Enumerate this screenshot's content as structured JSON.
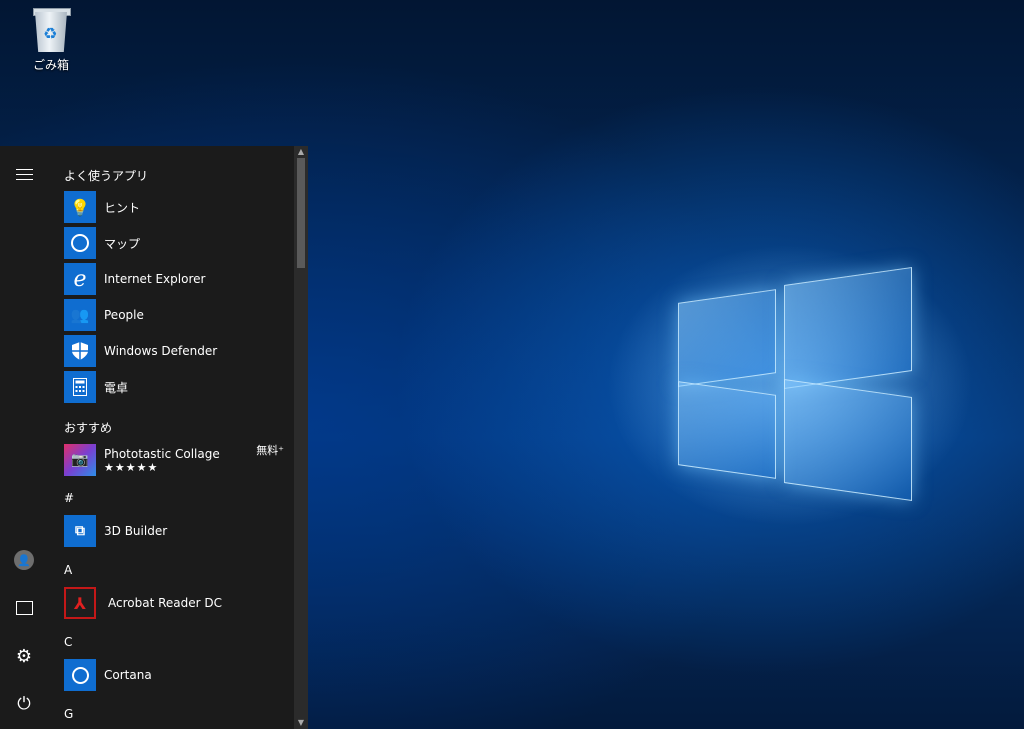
{
  "desktop": {
    "recycle_bin_label": "ごみ箱"
  },
  "start_menu": {
    "most_used_header": "よく使うアプリ",
    "most_used": [
      {
        "label": "ヒント",
        "icon": "lightbulb-icon"
      },
      {
        "label": "マップ",
        "icon": "maps-icon"
      },
      {
        "label": "Internet Explorer",
        "icon": "internet-explorer-icon"
      },
      {
        "label": "People",
        "icon": "people-icon"
      },
      {
        "label": "Windows Defender",
        "icon": "shield-icon"
      },
      {
        "label": "電卓",
        "icon": "calculator-icon"
      }
    ],
    "suggested_header": "おすすめ",
    "suggested": {
      "label": "Phototastic Collage",
      "rating": "★★★★★",
      "price": "無料⁺"
    },
    "sections": [
      {
        "letter": "#",
        "app": "3D Builder"
      },
      {
        "letter": "A",
        "app": "Acrobat Reader DC"
      },
      {
        "letter": "C",
        "app": "Cortana"
      },
      {
        "letter": "G"
      }
    ]
  },
  "colors": {
    "tile": "#0f6dd0",
    "menu_bg": "#1b1b1b"
  }
}
